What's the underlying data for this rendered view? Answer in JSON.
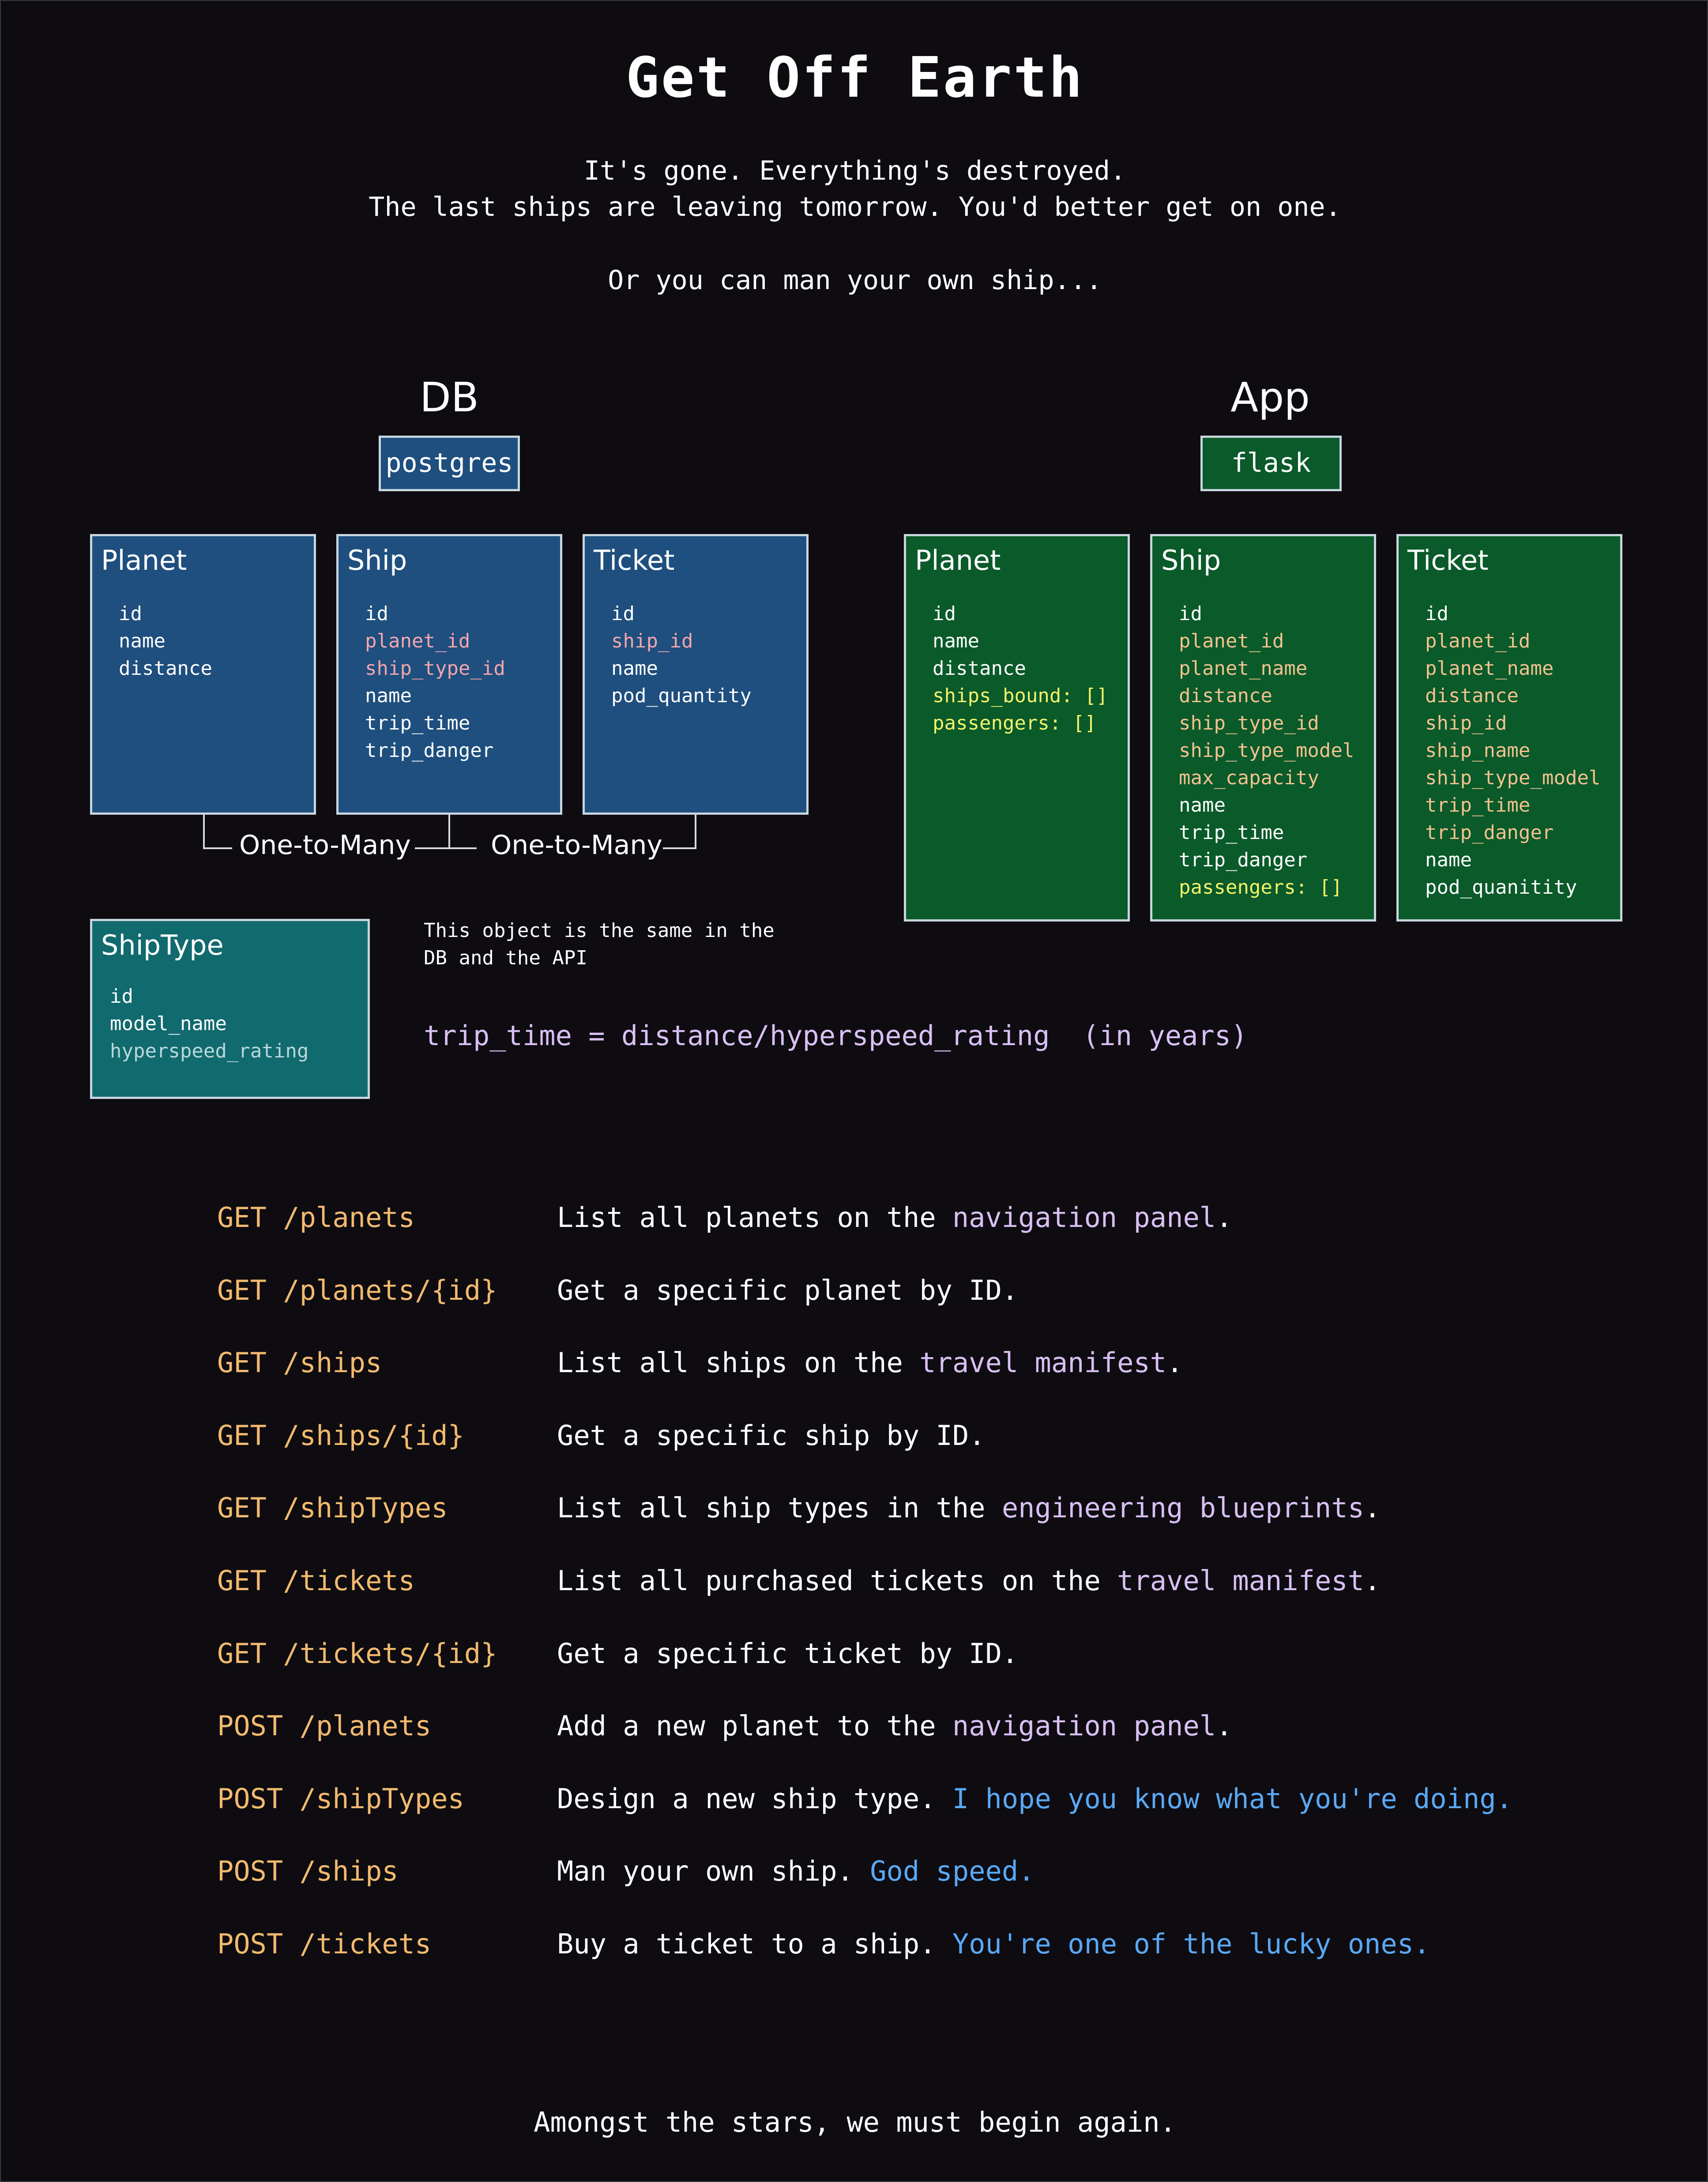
{
  "header": {
    "title": "Get Off Earth",
    "intro_line1": "It's gone. Everything's destroyed.",
    "intro_line2": "The last ships are leaving tomorrow. You'd better get on one.",
    "intro_line3": "Or you can man your own ship..."
  },
  "db": {
    "heading": "DB",
    "tag": "postgres",
    "tables": [
      {
        "title": "Planet",
        "fields": [
          "id",
          "name",
          "distance"
        ]
      },
      {
        "title": "Ship",
        "fields": [
          "id",
          "planet_id",
          "ship_type_id",
          "name",
          "trip_time",
          "trip_danger"
        ]
      },
      {
        "title": "Ticket",
        "fields": [
          "id",
          "ship_id",
          "name",
          "pod_quantity"
        ]
      }
    ],
    "relation_labels": [
      "One-to-Many",
      "One-to-Many"
    ]
  },
  "app": {
    "heading": "App",
    "tag": "flask",
    "models": [
      {
        "title": "Planet",
        "fields": [
          "id",
          "name",
          "distance",
          "ships_bound: []",
          "passengers: []"
        ]
      },
      {
        "title": "Ship",
        "fields": [
          "id",
          "planet_id",
          "planet_name",
          "distance",
          "ship_type_id",
          "ship_type_model",
          "max_capacity",
          "name",
          "trip_time",
          "trip_danger",
          "passengers: []"
        ]
      },
      {
        "title": "Ticket",
        "fields": [
          "id",
          "planet_id",
          "planet_name",
          "distance",
          "ship_id",
          "ship_name",
          "ship_type_model",
          "trip_time",
          "trip_danger",
          "name",
          "pod_quanitity"
        ]
      }
    ]
  },
  "shiptype": {
    "title": "ShipType",
    "fields": [
      "id",
      "model_name",
      "hyperspeed_rating"
    ],
    "note_line1": "This object is the same in the",
    "note_line2": "DB and the API",
    "formula": "trip_time = distance/hyperspeed_rating  (in years)"
  },
  "endpoints": [
    {
      "method_path": "GET /planets",
      "parts": [
        {
          "t": "List all planets on the ",
          "c": "plain"
        },
        {
          "t": "navigation panel",
          "c": "hl"
        },
        {
          "t": ".",
          "c": "plain"
        }
      ]
    },
    {
      "method_path": "GET /planets/{id}",
      "parts": [
        {
          "t": "Get a specific planet by ID.",
          "c": "plain"
        }
      ]
    },
    {
      "method_path": "GET /ships",
      "parts": [
        {
          "t": "List all ships on the ",
          "c": "plain"
        },
        {
          "t": "travel manifest",
          "c": "hl"
        },
        {
          "t": ".",
          "c": "plain"
        }
      ]
    },
    {
      "method_path": "GET /ships/{id}",
      "parts": [
        {
          "t": "Get a specific ship by ID.",
          "c": "plain"
        }
      ]
    },
    {
      "method_path": "GET /shipTypes",
      "parts": [
        {
          "t": "List all ship types in the ",
          "c": "plain"
        },
        {
          "t": "engineering blueprints",
          "c": "hl"
        },
        {
          "t": ".",
          "c": "plain"
        }
      ]
    },
    {
      "method_path": "GET /tickets",
      "parts": [
        {
          "t": "List all purchased tickets on the ",
          "c": "plain"
        },
        {
          "t": "travel manifest",
          "c": "hl"
        },
        {
          "t": ".",
          "c": "plain"
        }
      ]
    },
    {
      "method_path": "GET /tickets/{id}",
      "parts": [
        {
          "t": "Get a specific ticket by ID.",
          "c": "plain"
        }
      ]
    },
    {
      "method_path": "POST /planets",
      "parts": [
        {
          "t": "Add a new planet to the ",
          "c": "plain"
        },
        {
          "t": "navigation panel",
          "c": "hl"
        },
        {
          "t": ".",
          "c": "plain"
        }
      ]
    },
    {
      "method_path": "POST /shipTypes",
      "parts": [
        {
          "t": "Design a new ship type. ",
          "c": "plain"
        },
        {
          "t": "I hope you know what you're doing.",
          "c": "quip"
        }
      ]
    },
    {
      "method_path": "POST /ships",
      "parts": [
        {
          "t": "Man your own ship. ",
          "c": "plain"
        },
        {
          "t": "God speed.",
          "c": "quip"
        }
      ]
    },
    {
      "method_path": "POST /tickets",
      "parts": [
        {
          "t": "Buy a ticket to a ship. ",
          "c": "plain"
        },
        {
          "t": "You're one of the lucky ones.",
          "c": "quip"
        }
      ]
    }
  ],
  "footer": {
    "text": "Amongst the stars, we must begin again."
  },
  "colors": {
    "background": "#0e0c11",
    "db_box": "#1e4f7e",
    "app_box": "#0a5a2a",
    "shiptype_box": "#116a6e",
    "route": "#f2ba6e",
    "highlight": "#d9bff3",
    "quip": "#5aa8f4",
    "foreign_key": "#f4a5ae",
    "array_field": "#f3f26b"
  }
}
